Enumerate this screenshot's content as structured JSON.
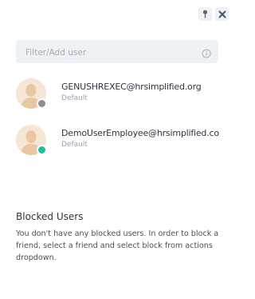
{
  "header": {
    "pin_icon": "pin-icon",
    "close_icon": "close-icon"
  },
  "search": {
    "placeholder": "Filter/Add user",
    "value": "",
    "info_icon": "info-icon"
  },
  "users": [
    {
      "name": "GENUSHREXEC@hrsimplified.org",
      "role": "Default",
      "status_color": "#8a8f96"
    },
    {
      "name": "DemoUserEmployee@hrsimplified.co",
      "role": "Default",
      "status_color": "#1dbf9a"
    }
  ],
  "blocked": {
    "title": "Blocked Users",
    "message": "You don't have any blocked users. In order to block a friend, select a friend and select block from actions dropdown."
  },
  "colors": {
    "field_bg": "#eef1f5",
    "avatar_bg": "#f4e3d1",
    "avatar_fg": "#e8c29c"
  }
}
